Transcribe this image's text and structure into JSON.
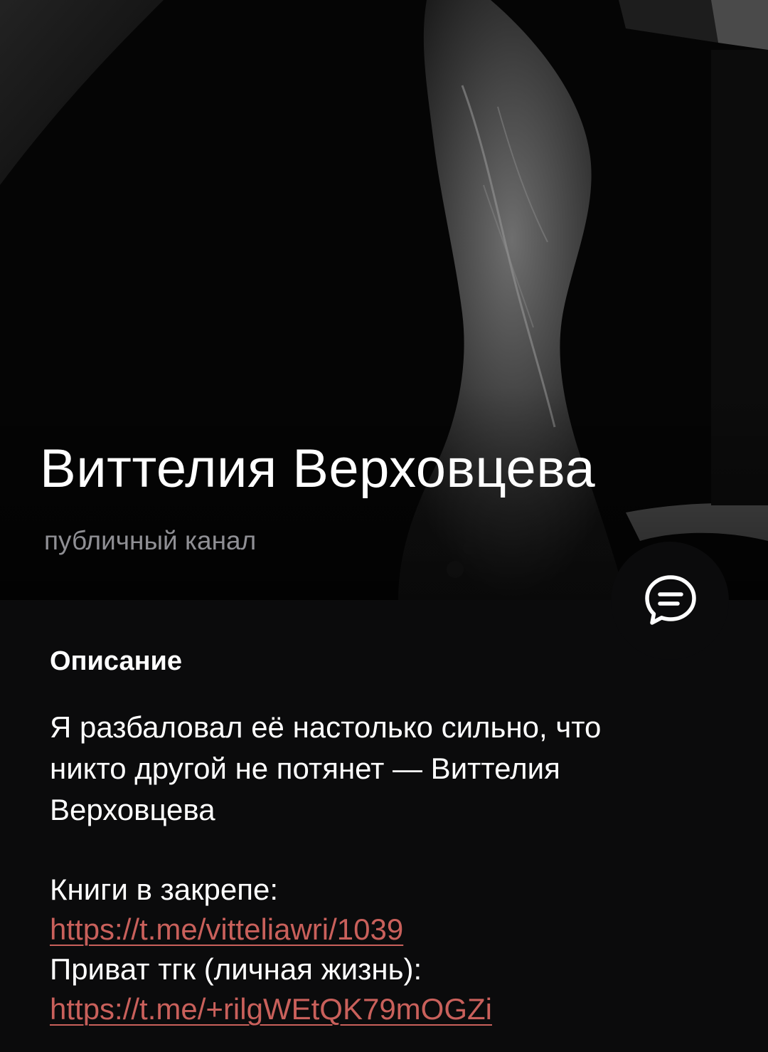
{
  "channel": {
    "name": "Виттелия Верховцева",
    "type_label": "публичный канал"
  },
  "description": {
    "title": "Описание",
    "lines": [
      "Я разбаловал её настолько сильно, что",
      "никто другой не потянет — Виттелия",
      "Верховцева",
      "Книги в закрепе:",
      "https://t.me/vitteliawri/1039",
      "Приват тгк (личная жизнь):",
      "https://t.me/+rilgWEtQK79mOGZi"
    ]
  },
  "icons": {
    "chat_button": "chat-bubble-icon"
  },
  "colors": {
    "background": "#0b0b0c",
    "link": "#c9605b",
    "secondary_text": "#8f8f94"
  }
}
